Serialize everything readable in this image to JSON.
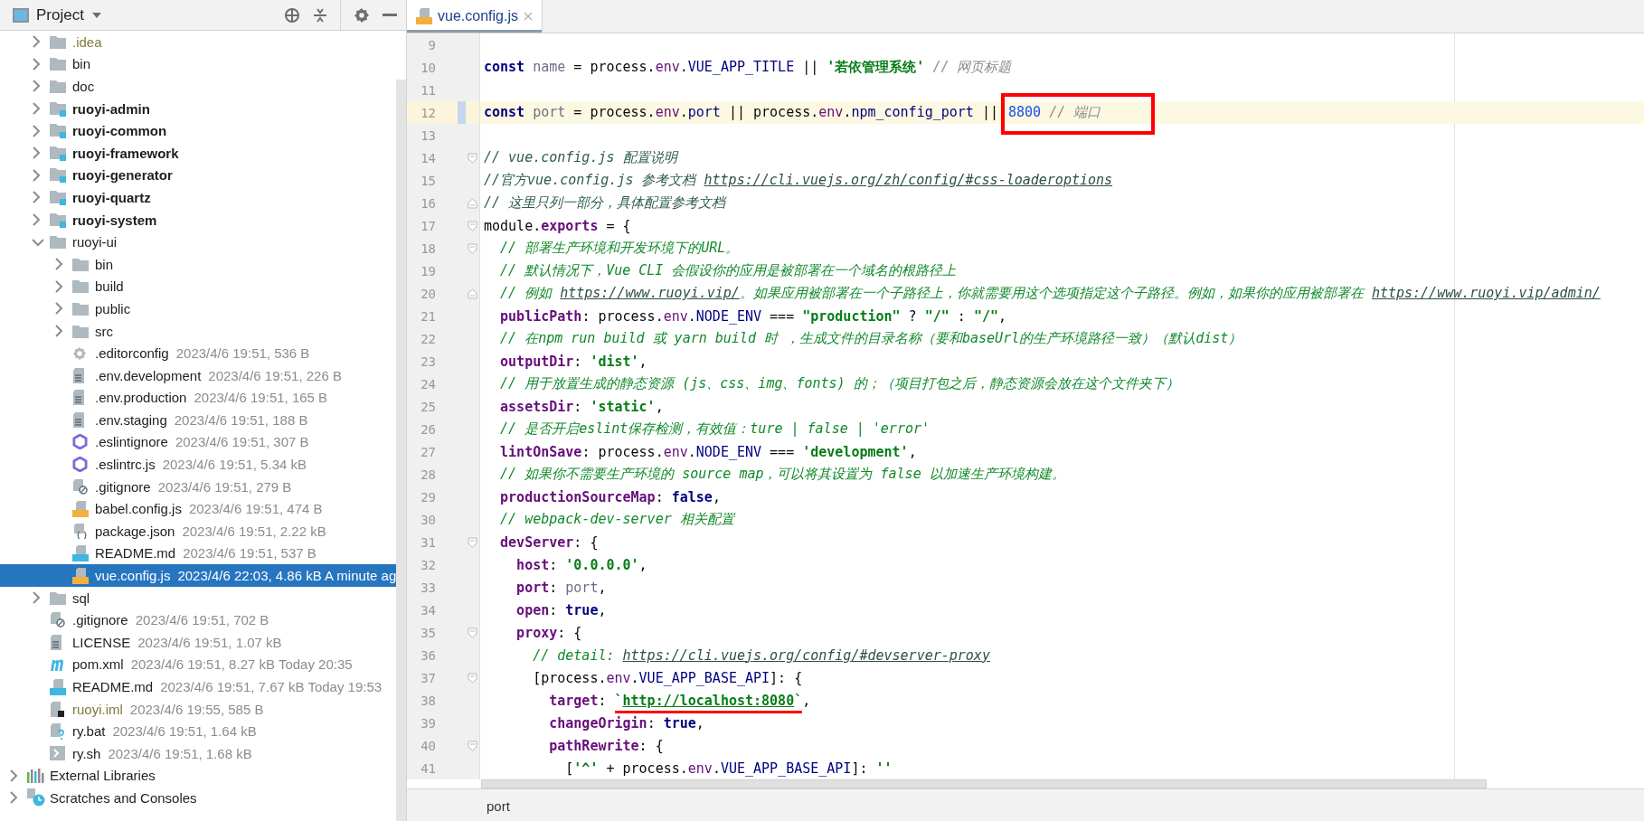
{
  "project_panel": {
    "title": "Project"
  },
  "tree": {
    "project_children": [
      {
        "name": ".idea",
        "kind": "folder",
        "bold": false,
        "ignored": true,
        "expanded": false,
        "selected": false
      },
      {
        "name": "bin",
        "kind": "folder",
        "bold": false,
        "ignored": false,
        "expanded": false,
        "selected": false
      },
      {
        "name": "doc",
        "kind": "folder",
        "bold": false,
        "ignored": false,
        "expanded": false,
        "selected": false
      },
      {
        "name": "ruoyi-admin",
        "kind": "module",
        "bold": true,
        "ignored": false,
        "expanded": false,
        "selected": false
      },
      {
        "name": "ruoyi-common",
        "kind": "module",
        "bold": true,
        "ignored": false,
        "expanded": false,
        "selected": false
      },
      {
        "name": "ruoyi-framework",
        "kind": "module",
        "bold": true,
        "ignored": false,
        "expanded": false,
        "selected": false
      },
      {
        "name": "ruoyi-generator",
        "kind": "module",
        "bold": true,
        "ignored": false,
        "expanded": false,
        "selected": false
      },
      {
        "name": "ruoyi-quartz",
        "kind": "module",
        "bold": true,
        "ignored": false,
        "expanded": false,
        "selected": false
      },
      {
        "name": "ruoyi-system",
        "kind": "module",
        "bold": true,
        "ignored": false,
        "expanded": false,
        "selected": false
      },
      {
        "name": "ruoyi-ui",
        "kind": "folder",
        "bold": false,
        "ignored": false,
        "expanded": true,
        "selected": false,
        "children": [
          {
            "name": "bin",
            "kind": "folder",
            "bold": false,
            "ignored": false,
            "expanded": false,
            "selected": false
          },
          {
            "name": "build",
            "kind": "folder",
            "bold": false,
            "ignored": false,
            "expanded": false,
            "selected": false
          },
          {
            "name": "public",
            "kind": "folder",
            "bold": false,
            "ignored": false,
            "expanded": false,
            "selected": false
          },
          {
            "name": "src",
            "kind": "folder",
            "bold": false,
            "ignored": false,
            "expanded": false,
            "selected": false
          },
          {
            "name": ".editorconfig",
            "meta": "2023/4/6 19:51, 536 B",
            "kind": "gear",
            "bold": false,
            "ignored": false,
            "selected": false
          },
          {
            "name": ".env.development",
            "meta": "2023/4/6 19:51, 226 B",
            "kind": "text",
            "bold": false,
            "ignored": false,
            "selected": false
          },
          {
            "name": ".env.production",
            "meta": "2023/4/6 19:51, 165 B",
            "kind": "text",
            "bold": false,
            "ignored": false,
            "selected": false
          },
          {
            "name": ".env.staging",
            "meta": "2023/4/6 19:51, 188 B",
            "kind": "text",
            "bold": false,
            "ignored": false,
            "selected": false
          },
          {
            "name": ".eslintignore",
            "meta": "2023/4/6 19:51, 307 B",
            "kind": "eslint",
            "bold": false,
            "ignored": false,
            "selected": false
          },
          {
            "name": ".eslintrc.js",
            "meta": "2023/4/6 19:51, 5.34 kB",
            "kind": "eslint",
            "bold": false,
            "ignored": false,
            "selected": false
          },
          {
            "name": ".gitignore",
            "meta": "2023/4/6 19:51, 279 B",
            "kind": "gitignore",
            "bold": false,
            "ignored": false,
            "selected": false
          },
          {
            "name": "babel.config.js",
            "meta": "2023/4/6 19:51, 474 B",
            "kind": "js",
            "bold": false,
            "ignored": false,
            "selected": false
          },
          {
            "name": "package.json",
            "meta": "2023/4/6 19:51, 2.22 kB",
            "kind": "json",
            "bold": false,
            "ignored": false,
            "selected": false
          },
          {
            "name": "README.md",
            "meta": "2023/4/6 19:51, 537 B",
            "kind": "md",
            "bold": false,
            "ignored": false,
            "selected": false
          },
          {
            "name": "vue.config.js",
            "meta": "2023/4/6 22:03, 4.86 kB A minute ag",
            "kind": "js",
            "bold": false,
            "ignored": false,
            "selected": true
          }
        ]
      },
      {
        "name": "sql",
        "kind": "folder",
        "bold": false,
        "ignored": false,
        "expanded": false,
        "selected": false
      },
      {
        "name": ".gitignore",
        "meta": "2023/4/6 19:51, 702 B",
        "kind": "gitignore",
        "bold": false,
        "ignored": false,
        "selected": false
      },
      {
        "name": "LICENSE",
        "meta": "2023/4/6 19:51, 1.07 kB",
        "kind": "text",
        "bold": false,
        "ignored": false,
        "selected": false
      },
      {
        "name": "pom.xml",
        "meta": "2023/4/6 19:51, 8.27 kB Today 20:35",
        "kind": "maven",
        "bold": false,
        "ignored": false,
        "selected": false
      },
      {
        "name": "README.md",
        "meta": "2023/4/6 19:51, 7.67 kB Today 19:53",
        "kind": "md",
        "bold": false,
        "ignored": false,
        "selected": false
      },
      {
        "name": "ruoyi.iml",
        "meta": "2023/4/6 19:55, 585 B",
        "kind": "iml",
        "bold": false,
        "ignored": true,
        "selected": false
      },
      {
        "name": "ry.bat",
        "meta": "2023/4/6 19:51, 1.64 kB",
        "kind": "bat",
        "bold": false,
        "ignored": false,
        "selected": false
      },
      {
        "name": "ry.sh",
        "meta": "2023/4/6 19:51, 1.68 kB",
        "kind": "shell",
        "bold": false,
        "ignored": false,
        "selected": false
      }
    ],
    "roots": [
      {
        "name": "External Libraries",
        "kind": "libraries",
        "bold": false,
        "ignored": false,
        "expanded": false,
        "selected": false
      },
      {
        "name": "Scratches and Consoles",
        "kind": "scratches",
        "bold": false,
        "ignored": false,
        "expanded": false,
        "selected": false
      }
    ]
  },
  "tabs": [
    {
      "label": "vue.config.js",
      "kind": "js",
      "selected": true
    }
  ],
  "editor": {
    "lines": [
      {
        "number": "9",
        "current": false,
        "changed": false
      },
      {
        "number": "10",
        "current": false,
        "changed": false,
        "tokens": [
          {
            "kind": "kw",
            "text": "const "
          },
          {
            "kind": "local",
            "text": "name"
          },
          {
            "kind": "plain",
            "text": " = process."
          },
          {
            "kind": "field",
            "text": "env"
          },
          {
            "kind": "plain",
            "text": "."
          },
          {
            "kind": "const",
            "text": "VUE_APP_TITLE"
          },
          {
            "kind": "plain",
            "text": " || "
          },
          {
            "kind": "str",
            "text": "'若依管理系统'"
          },
          {
            "kind": "cmt",
            "text": " // 网页标题"
          }
        ]
      },
      {
        "number": "11",
        "current": false,
        "changed": false
      },
      {
        "number": "12",
        "current": true,
        "changed": true,
        "tokens": [
          {
            "kind": "kw",
            "text": "const "
          },
          {
            "kind": "local",
            "text": "port"
          },
          {
            "kind": "plain",
            "text": " = process."
          },
          {
            "kind": "field",
            "text": "env"
          },
          {
            "kind": "plain",
            "text": "."
          },
          {
            "kind": "const",
            "text": "port"
          },
          {
            "kind": "plain",
            "text": " || process."
          },
          {
            "kind": "field",
            "text": "env"
          },
          {
            "kind": "plain",
            "text": "."
          },
          {
            "kind": "const",
            "text": "npm_config_port"
          },
          {
            "kind": "plain",
            "text": " || "
          },
          {
            "kind": "num",
            "text": "8800",
            "boxed": true
          },
          {
            "kind": "cmt",
            "text": " // 端口",
            "boxed": true
          }
        ]
      },
      {
        "number": "13",
        "current": false,
        "changed": false
      },
      {
        "number": "14",
        "current": false,
        "changed": false,
        "fold_start": true,
        "tokens": [
          {
            "kind": "cmt2",
            "text": "// vue.config.js 配置说明"
          }
        ]
      },
      {
        "number": "15",
        "current": false,
        "changed": false,
        "tokens": [
          {
            "kind": "cmt2",
            "text": "//官方vue.config.js 参考文档 "
          },
          {
            "kind": "link",
            "text": "https://cli.vuejs.org/zh/config/#css-loaderoptions"
          }
        ]
      },
      {
        "number": "16",
        "current": false,
        "changed": false,
        "fold_end": true,
        "tokens": [
          {
            "kind": "cmt2",
            "text": "// 这里只列一部分，具体配置参考文档"
          }
        ]
      },
      {
        "number": "17",
        "current": false,
        "changed": false,
        "fold_start": true,
        "tokens": [
          {
            "kind": "plain",
            "text": "module."
          },
          {
            "kind": "prop",
            "text": "exports"
          },
          {
            "kind": "plain",
            "text": " = {"
          }
        ]
      },
      {
        "number": "18",
        "current": false,
        "changed": false,
        "fold_start": true,
        "tokens": [
          {
            "kind": "doc",
            "text": "  // 部署生产环境和开发环境下的URL。"
          }
        ]
      },
      {
        "number": "19",
        "current": false,
        "changed": false,
        "tokens": [
          {
            "kind": "doc",
            "text": "  // 默认情况下，Vue CLI 会假设你的应用是被部署在一个域名的根路径上"
          }
        ]
      },
      {
        "number": "20",
        "current": false,
        "changed": false,
        "fold_end": true,
        "tokens": [
          {
            "kind": "doc",
            "text": "  // 例如 "
          },
          {
            "kind": "link",
            "text": "https://www.ruoyi.vip/"
          },
          {
            "kind": "doc",
            "text": "。如果应用被部署在一个子路径上，你就需要用这个选项指定这个子路径。例如，如果你的应用被部署在 "
          },
          {
            "kind": "link",
            "text": "https://www.ruoyi.vip/admin/"
          }
        ]
      },
      {
        "number": "21",
        "current": false,
        "changed": false,
        "tokens": [
          {
            "kind": "prop",
            "text": "  publicPath"
          },
          {
            "kind": "plain",
            "text": ": process."
          },
          {
            "kind": "field",
            "text": "env"
          },
          {
            "kind": "plain",
            "text": "."
          },
          {
            "kind": "const",
            "text": "NODE_ENV"
          },
          {
            "kind": "plain",
            "text": " === "
          },
          {
            "kind": "str",
            "text": "\"production\""
          },
          {
            "kind": "plain",
            "text": " ? "
          },
          {
            "kind": "str",
            "text": "\"/\""
          },
          {
            "kind": "plain",
            "text": " : "
          },
          {
            "kind": "str",
            "text": "\"/\""
          },
          {
            "kind": "plain",
            "text": ","
          }
        ]
      },
      {
        "number": "22",
        "current": false,
        "changed": false,
        "tokens": [
          {
            "kind": "doc",
            "text": "  // 在npm run build 或 yarn build 时 ，生成文件的目录名称（要和baseUrl的生产环境路径一致）（默认dist）"
          }
        ]
      },
      {
        "number": "23",
        "current": false,
        "changed": false,
        "tokens": [
          {
            "kind": "prop",
            "text": "  outputDir"
          },
          {
            "kind": "plain",
            "text": ": "
          },
          {
            "kind": "str",
            "text": "'dist'"
          },
          {
            "kind": "plain",
            "text": ","
          }
        ]
      },
      {
        "number": "24",
        "current": false,
        "changed": false,
        "tokens": [
          {
            "kind": "doc",
            "text": "  // 用于放置生成的静态资源 (js、css、img、fonts) 的；（项目打包之后，静态资源会放在这个文件夹下）"
          }
        ]
      },
      {
        "number": "25",
        "current": false,
        "changed": false,
        "tokens": [
          {
            "kind": "prop",
            "text": "  assetsDir"
          },
          {
            "kind": "plain",
            "text": ": "
          },
          {
            "kind": "str",
            "text": "'static'"
          },
          {
            "kind": "plain",
            "text": ","
          }
        ]
      },
      {
        "number": "26",
        "current": false,
        "changed": false,
        "tokens": [
          {
            "kind": "doc",
            "text": "  // 是否开启eslint保存检测，有效值：ture | false | 'error'"
          }
        ]
      },
      {
        "number": "27",
        "current": false,
        "changed": false,
        "tokens": [
          {
            "kind": "prop",
            "text": "  lintOnSave"
          },
          {
            "kind": "plain",
            "text": ": process."
          },
          {
            "kind": "field",
            "text": "env"
          },
          {
            "kind": "plain",
            "text": "."
          },
          {
            "kind": "const",
            "text": "NODE_ENV"
          },
          {
            "kind": "plain",
            "text": " === "
          },
          {
            "kind": "str",
            "text": "'development'"
          },
          {
            "kind": "plain",
            "text": ","
          }
        ]
      },
      {
        "number": "28",
        "current": false,
        "changed": false,
        "tokens": [
          {
            "kind": "doc",
            "text": "  // 如果你不需要生产环境的 source map，可以将其设置为 false 以加速生产环境构建。"
          }
        ]
      },
      {
        "number": "29",
        "current": false,
        "changed": false,
        "tokens": [
          {
            "kind": "prop",
            "text": "  productionSourceMap"
          },
          {
            "kind": "plain",
            "text": ": "
          },
          {
            "kind": "kw",
            "text": "false"
          },
          {
            "kind": "plain",
            "text": ","
          }
        ]
      },
      {
        "number": "30",
        "current": false,
        "changed": false,
        "tokens": [
          {
            "kind": "doc",
            "text": "  // webpack-dev-server 相关配置"
          }
        ]
      },
      {
        "number": "31",
        "current": false,
        "changed": false,
        "fold_start": true,
        "tokens": [
          {
            "kind": "prop",
            "text": "  devServer"
          },
          {
            "kind": "plain",
            "text": ": {"
          }
        ]
      },
      {
        "number": "32",
        "current": false,
        "changed": false,
        "tokens": [
          {
            "kind": "prop",
            "text": "    host"
          },
          {
            "kind": "plain",
            "text": ": "
          },
          {
            "kind": "str",
            "text": "'0.0.0.0'"
          },
          {
            "kind": "plain",
            "text": ","
          }
        ]
      },
      {
        "number": "33",
        "current": false,
        "changed": false,
        "tokens": [
          {
            "kind": "prop",
            "text": "    port"
          },
          {
            "kind": "plain",
            "text": ": "
          },
          {
            "kind": "local",
            "text": "port"
          },
          {
            "kind": "plain",
            "text": ","
          }
        ]
      },
      {
        "number": "34",
        "current": false,
        "changed": false,
        "tokens": [
          {
            "kind": "prop",
            "text": "    open"
          },
          {
            "kind": "plain",
            "text": ": "
          },
          {
            "kind": "kw",
            "text": "true"
          },
          {
            "kind": "plain",
            "text": ","
          }
        ]
      },
      {
        "number": "35",
        "current": false,
        "changed": false,
        "fold_start": true,
        "tokens": [
          {
            "kind": "prop",
            "text": "    proxy"
          },
          {
            "kind": "plain",
            "text": ": {"
          }
        ]
      },
      {
        "number": "36",
        "current": false,
        "changed": false,
        "tokens": [
          {
            "kind": "doc",
            "text": "      // detail: "
          },
          {
            "kind": "link",
            "text": "https://cli.vuejs.org/config/#devserver-proxy"
          }
        ]
      },
      {
        "number": "37",
        "current": false,
        "changed": false,
        "fold_start": true,
        "tokens": [
          {
            "kind": "plain",
            "text": "      [process."
          },
          {
            "kind": "field",
            "text": "env"
          },
          {
            "kind": "plain",
            "text": "."
          },
          {
            "kind": "const",
            "text": "VUE_APP_BASE_API"
          },
          {
            "kind": "plain",
            "text": "]: {"
          }
        ]
      },
      {
        "number": "38",
        "current": false,
        "changed": false,
        "tokens": [
          {
            "kind": "prop",
            "text": "        target"
          },
          {
            "kind": "plain",
            "text": ": "
          },
          {
            "kind": "str",
            "text": "`",
            "underlined": true
          },
          {
            "kind": "strlink",
            "text": "http://localhost:8080",
            "underlined": true
          },
          {
            "kind": "str",
            "text": "`",
            "underlined": true
          },
          {
            "kind": "plain",
            "text": ","
          }
        ]
      },
      {
        "number": "39",
        "current": false,
        "changed": false,
        "tokens": [
          {
            "kind": "prop",
            "text": "        changeOrigin"
          },
          {
            "kind": "plain",
            "text": ": "
          },
          {
            "kind": "kw",
            "text": "true"
          },
          {
            "kind": "plain",
            "text": ","
          }
        ]
      },
      {
        "number": "40",
        "current": false,
        "changed": false,
        "fold_start": true,
        "tokens": [
          {
            "kind": "prop",
            "text": "        pathRewrite"
          },
          {
            "kind": "plain",
            "text": ": {"
          }
        ]
      },
      {
        "number": "41",
        "current": false,
        "changed": false,
        "tokens": [
          {
            "kind": "plain",
            "text": "          ["
          },
          {
            "kind": "str",
            "text": "'^'"
          },
          {
            "kind": "plain",
            "text": " + process."
          },
          {
            "kind": "field",
            "text": "env"
          },
          {
            "kind": "plain",
            "text": "."
          },
          {
            "kind": "const",
            "text": "VUE_APP_BASE_API"
          },
          {
            "kind": "plain",
            "text": "]: "
          },
          {
            "kind": "str",
            "text": "''"
          }
        ]
      }
    ]
  },
  "status_bar": {
    "breadcrumb": "port"
  }
}
